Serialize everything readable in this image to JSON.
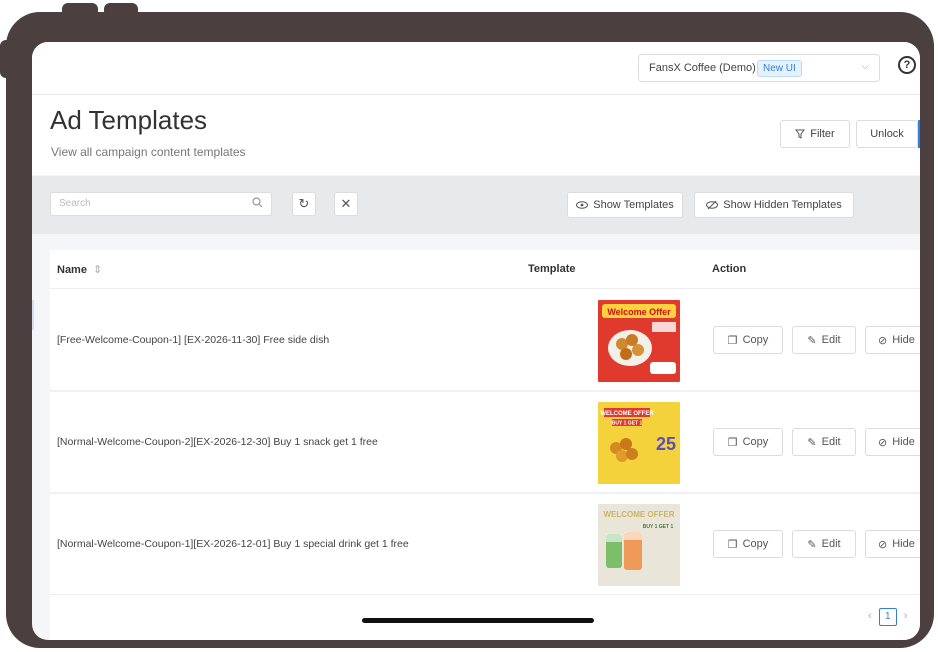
{
  "topbar": {
    "account_name": "FansX Coffee (Demo)",
    "account_badge": "New UI",
    "help_icon": "?"
  },
  "header": {
    "title": "Ad Templates",
    "subtitle": "View all campaign content templates",
    "filter_label": "Filter",
    "unlock_label": "Unlock"
  },
  "toolbar": {
    "search_placeholder": "Search",
    "show_templates_label": "Show Templates",
    "show_hidden_label": "Show Hidden Templates"
  },
  "table": {
    "columns": [
      "Name",
      "Template",
      "Action"
    ],
    "rows": [
      {
        "name": "[Free-Welcome-Coupon-1] [EX-2026-11-30] Free side dish",
        "thumb_text": "Welcome Offer",
        "thumb_bg": "#e03a2f"
      },
      {
        "name": "[Normal-Welcome-Coupon-2][EX-2026-12-30] Buy 1 snack get 1 free",
        "thumb_text": "WELCOME OFFER",
        "thumb_sub": "BUY 1 GET 1",
        "thumb_num": "25",
        "thumb_bg": "#f4d23c"
      },
      {
        "name": "[Normal-Welcome-Coupon-1][EX-2026-12-01] Buy 1 special drink get 1 free",
        "thumb_text": "WELCOME OFFER",
        "thumb_sub": "BUY 1 GET 1",
        "thumb_bg": "#e9e6d9"
      }
    ],
    "actions": {
      "copy": "Copy",
      "edit": "Edit",
      "hide": "Hide"
    }
  },
  "pagination": {
    "current": "1",
    "prev": "‹",
    "next": "›"
  },
  "colors": {
    "accent": "#2f7fe0",
    "frame": "#4b3f3f"
  }
}
